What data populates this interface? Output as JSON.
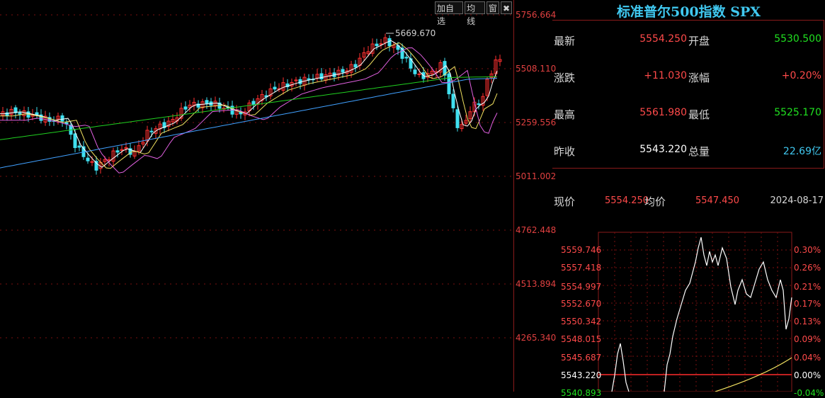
{
  "toolbar": {
    "add_label": "加自选",
    "ma_label": "均线",
    "window_label": "窗",
    "close_label": "✖"
  },
  "kline": {
    "yaxis_ticks": [
      "5756.664",
      "5508.110",
      "5259.556",
      "5011.002",
      "4762.448",
      "4513.894",
      "4265.340"
    ],
    "high_marker": "5669.670",
    "colors": {
      "up": "#ff3030",
      "down": "#40e0f0",
      "ma5": "#ffffff",
      "ma10": "#f0e060",
      "ma20": "#e060e0",
      "ma30": "#20d020",
      "ma60": "#40a0ff"
    }
  },
  "quote": {
    "title": "标准普尔500指数 SPX",
    "rows": [
      {
        "l1": "最新",
        "v1": "5554.250",
        "l2": "开盘",
        "v2": "5530.500",
        "c2": "#20e020"
      },
      {
        "l1": "涨跌",
        "v1": "+11.030",
        "l2": "涨幅",
        "v2": "+0.20%",
        "c2": "#ff4a4a"
      },
      {
        "l1": "最高",
        "v1": "5561.980",
        "l2": "最低",
        "v2": "5525.170",
        "c2": "#20e020"
      },
      {
        "l1": "昨收",
        "v1": "5543.220",
        "l2": "总量",
        "v2": "22.69亿",
        "c2": "#40c8f0"
      }
    ],
    "price_label": "现价",
    "price_value": "5554.250",
    "avg_label": "均价",
    "avg_value": "5547.450",
    "date": "2024-08-17"
  },
  "intraday": {
    "left_ticks": [
      "5559.746",
      "5557.418",
      "5554.997",
      "5552.670",
      "5550.342",
      "5548.015",
      "5545.687",
      "5543.220",
      "5540.893"
    ],
    "right_ticks": [
      "0.30%",
      "0.26%",
      "0.21%",
      "0.17%",
      "0.13%",
      "0.09%",
      "0.04%",
      "0.00%",
      "-0.04%"
    ]
  }
}
